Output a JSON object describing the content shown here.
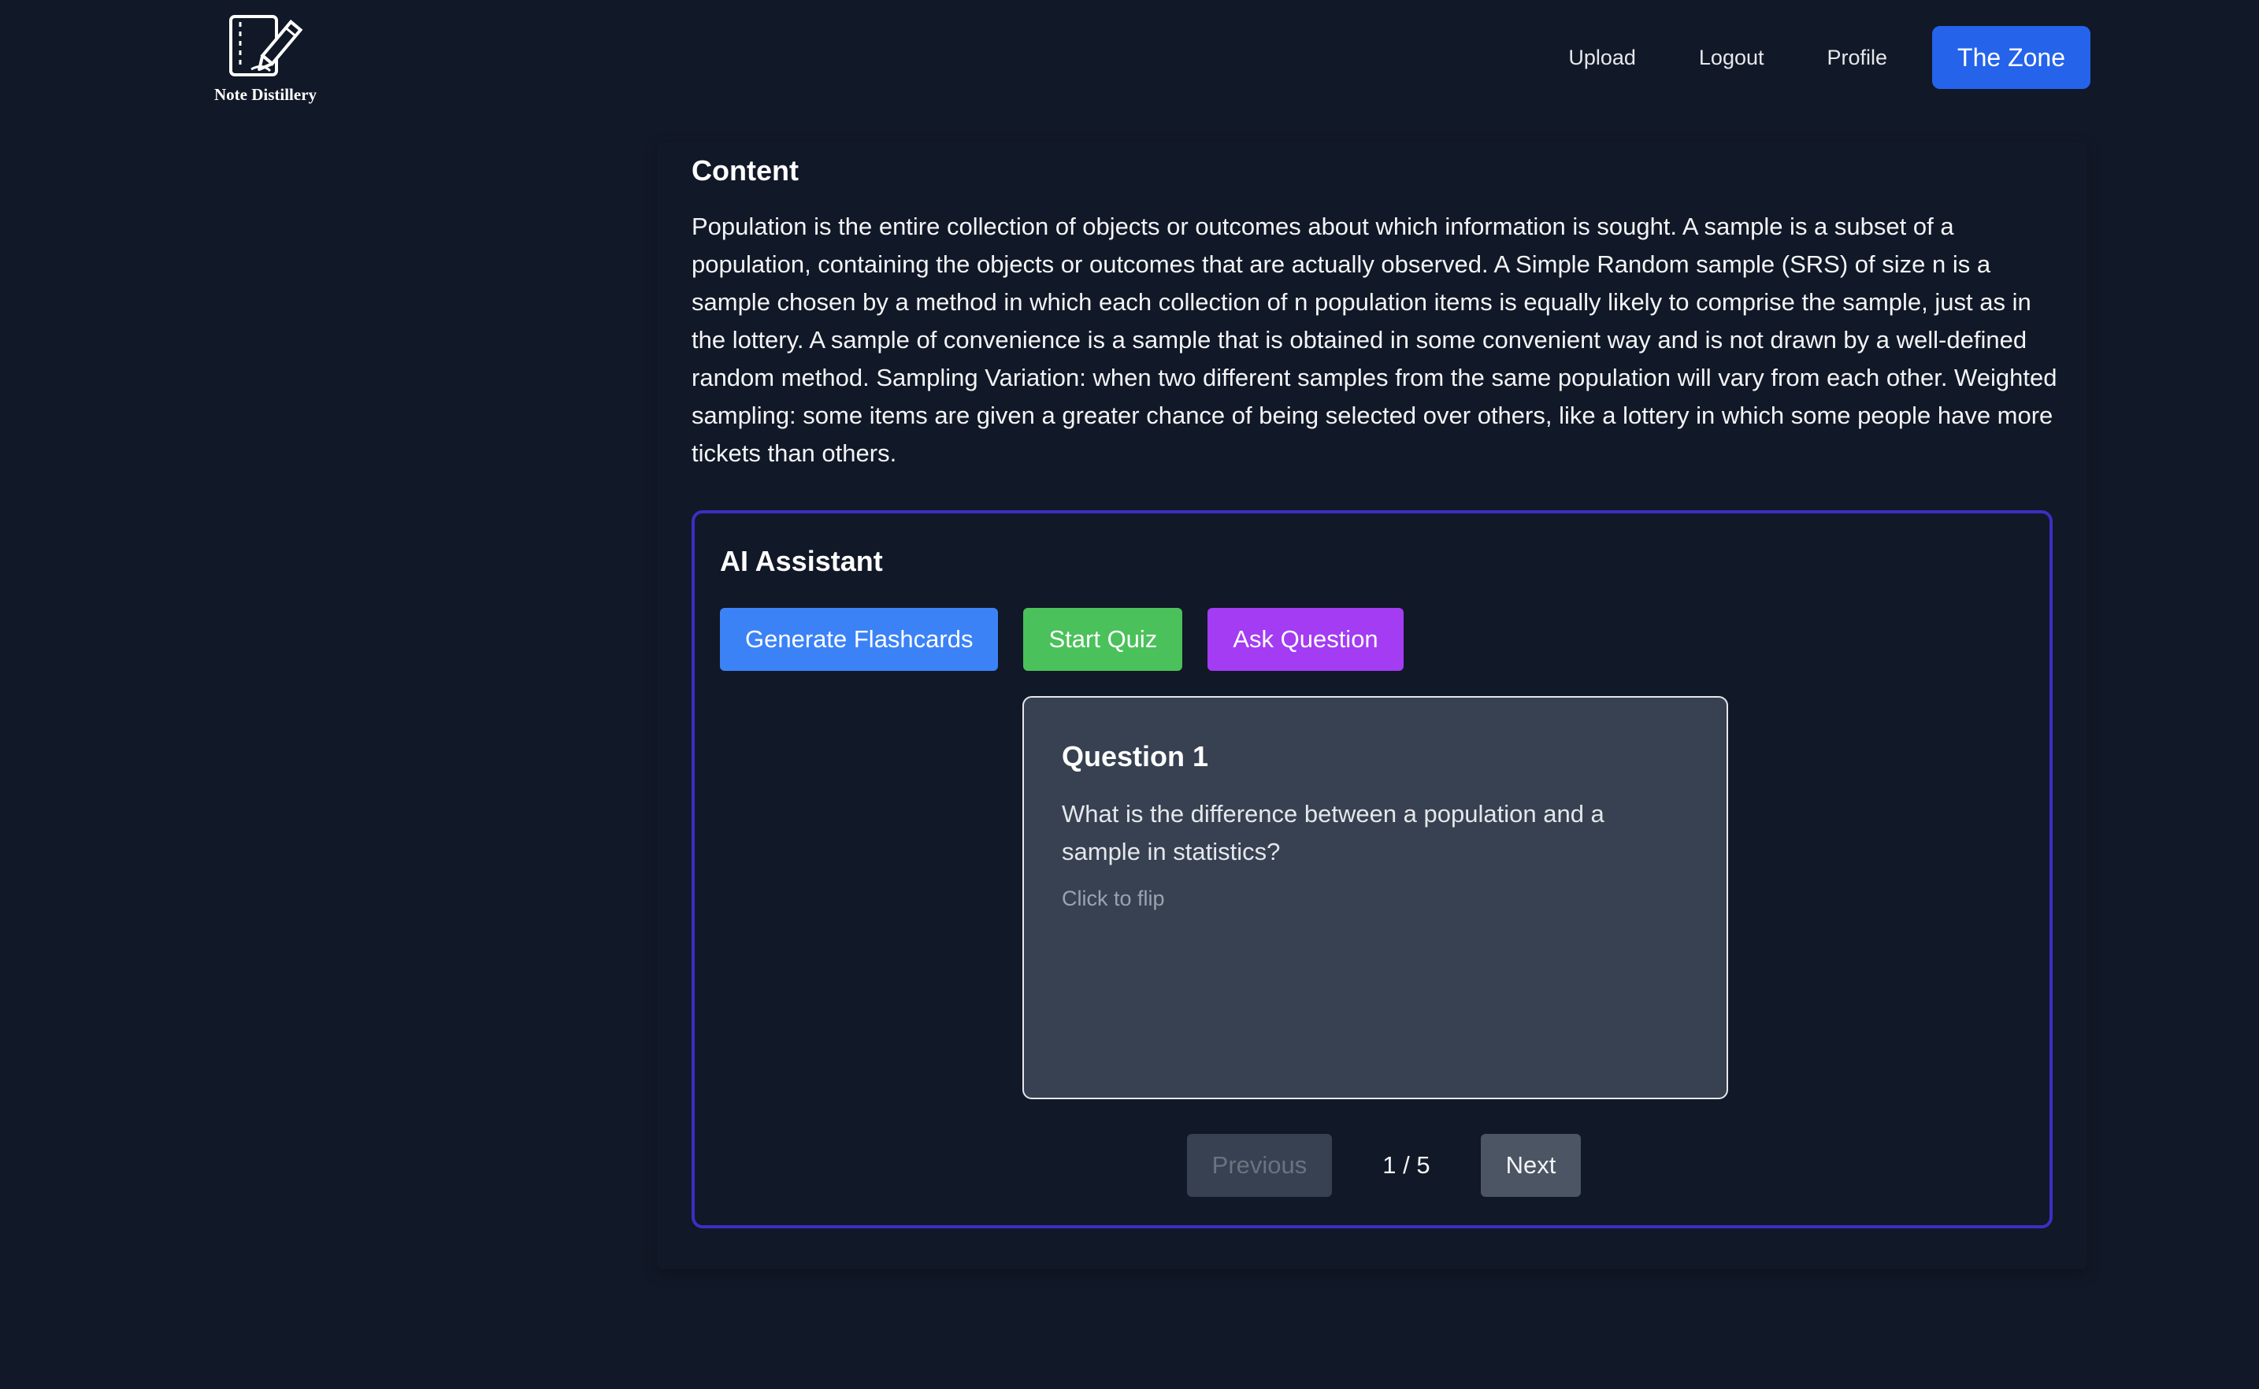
{
  "header": {
    "logo_text": "Note Distillery",
    "logo_icon": "notebook-pencil-icon",
    "nav": {
      "upload": "Upload",
      "logout": "Logout",
      "profile": "Profile",
      "zone": "The Zone"
    }
  },
  "content": {
    "title": "Content",
    "body": "Population is the entire collection of objects or outcomes about which information is sought. A sample is a subset of a population, containing the objects or outcomes that are actually observed. A Simple Random sample (SRS) of size n is a sample chosen by a method in which each collection of n population items is equally likely to comprise the sample, just as in the lottery. A sample of convenience is a sample that is obtained in some convenient way and is not drawn by a well-defined random method. Sampling Variation: when two different samples from the same population will vary from each other. Weighted sampling: some items are given a greater chance of being selected over others, like a lottery in which some people have more tickets than others."
  },
  "assistant": {
    "title": "AI Assistant",
    "actions": {
      "flashcards": "Generate Flashcards",
      "quiz": "Start Quiz",
      "ask": "Ask Question"
    },
    "card": {
      "title": "Question 1",
      "question": "What is the difference between a population and a sample in statistics?",
      "hint": "Click to flip"
    },
    "pager": {
      "previous": "Previous",
      "indicator": "1 / 5",
      "next": "Next"
    }
  },
  "colors": {
    "background": "#111827",
    "accent_blue": "#2563eb",
    "flashcards_blue": "#3b82f6",
    "quiz_green": "#4ac15a",
    "ask_purple": "#a33cf2",
    "panel_border": "#3b2fc4",
    "card_background": "#374151"
  }
}
